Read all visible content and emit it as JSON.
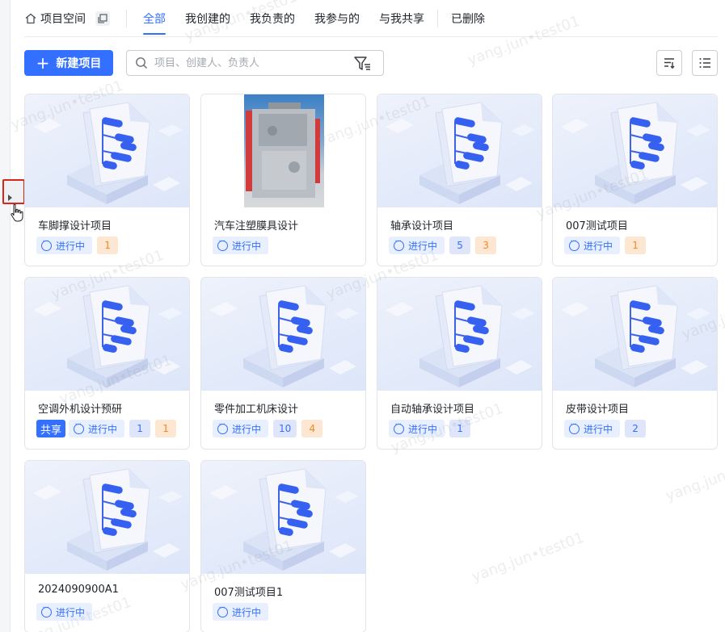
{
  "header": {
    "space_label": "项目空间",
    "tabs": [
      {
        "label": "全部",
        "active": true
      },
      {
        "label": "我创建的",
        "active": false
      },
      {
        "label": "我负责的",
        "active": false
      },
      {
        "label": "我参与的",
        "active": false
      },
      {
        "label": "与我共享",
        "active": false
      },
      {
        "label": "已删除",
        "active": false
      }
    ]
  },
  "toolbar": {
    "new_button_label": "新建项目",
    "search_placeholder": "项目、创建人、负责人"
  },
  "watermark_text": "yang.jun•test01",
  "projects": [
    {
      "title": "车脚撑设计项目",
      "status": "进行中",
      "blue": "",
      "orange": "1",
      "shared": false,
      "photo": false
    },
    {
      "title": "汽车注塑膜具设计",
      "status": "进行中",
      "blue": "",
      "orange": "",
      "shared": false,
      "photo": true
    },
    {
      "title": "轴承设计项目",
      "status": "进行中",
      "blue": "5",
      "orange": "3",
      "shared": false,
      "photo": false
    },
    {
      "title": "007测试项目",
      "status": "进行中",
      "blue": "",
      "orange": "1",
      "shared": false,
      "photo": false
    },
    {
      "title": "空调外机设计预研",
      "status": "进行中",
      "blue": "1",
      "orange": "1",
      "shared": true,
      "share_label": "共享",
      "photo": false
    },
    {
      "title": "零件加工机床设计",
      "status": "进行中",
      "blue": "10",
      "orange": "4",
      "shared": false,
      "photo": false
    },
    {
      "title": "自动轴承设计项目",
      "status": "进行中",
      "blue": "1",
      "orange": "",
      "shared": false,
      "photo": false
    },
    {
      "title": "皮带设计项目",
      "status": "进行中",
      "blue": "2",
      "orange": "",
      "shared": false,
      "photo": false
    },
    {
      "title": "2024090900A1",
      "status": "进行中",
      "blue": "",
      "orange": "",
      "shared": false,
      "photo": false
    },
    {
      "title": "007测试项目1",
      "status": "进行中",
      "blue": "",
      "orange": "",
      "shared": false,
      "photo": false
    }
  ],
  "colors": {
    "accent": "#3370ff",
    "orange": "#f08a24",
    "highlight_border": "#d9261c"
  },
  "icons": [
    "home-icon",
    "copy-icon",
    "search-icon",
    "filter-icon",
    "sort-icon",
    "list-view-icon",
    "project-doc-icon",
    "status-icon",
    "expand-arrow-icon",
    "hand-cursor-icon"
  ]
}
